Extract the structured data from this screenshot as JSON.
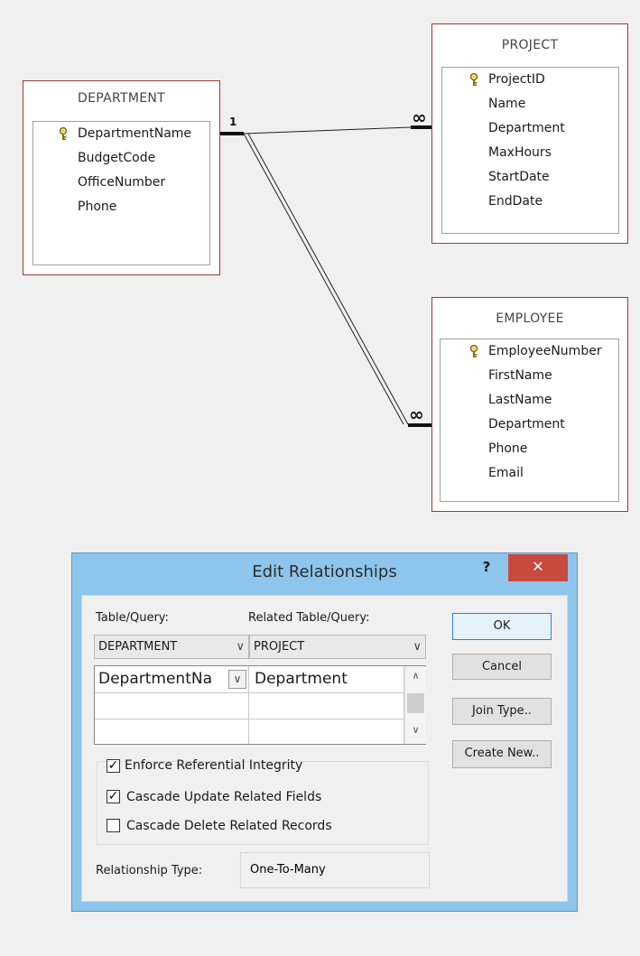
{
  "tables": {
    "department": {
      "title": "DEPARTMENT",
      "fields": [
        "DepartmentName",
        "BudgetCode",
        "OfficeNumber",
        "Phone"
      ]
    },
    "project": {
      "title": "PROJECT",
      "fields": [
        "ProjectID",
        "Name",
        "Department",
        "MaxHours",
        "StartDate",
        "EndDate"
      ]
    },
    "employee": {
      "title": "EMPLOYEE",
      "fields": [
        "EmployeeNumber",
        "FirstName",
        "LastName",
        "Department",
        "Phone",
        "Email"
      ]
    }
  },
  "relationships": {
    "one_label": "1",
    "many_label": "∞"
  },
  "dialog": {
    "title": "Edit Relationships",
    "help": "?",
    "close": "✕",
    "table_query_label": "Table/Query:",
    "related_table_query_label": "Related Table/Query:",
    "table_query_value": "DEPARTMENT",
    "related_table_query_value": "PROJECT",
    "grid": {
      "rows": [
        {
          "left": "DepartmentNa",
          "right": "Department"
        },
        {
          "left": "",
          "right": ""
        },
        {
          "left": "",
          "right": ""
        }
      ]
    },
    "buttons": {
      "ok": "OK",
      "cancel": "Cancel",
      "join_type": "Join Type..",
      "create_new": "Create New.."
    },
    "enforce_label": "Enforce Referential Integrity",
    "enforce_checked": true,
    "cascade_update_label": "Cascade Update Related Fields",
    "cascade_update_checked": true,
    "cascade_delete_label": "Cascade Delete Related Records",
    "cascade_delete_checked": false,
    "relationship_type_label": "Relationship Type:",
    "relationship_type_value": "One-To-Many"
  },
  "colors": {
    "table_border": "#9a3b3b",
    "dialog_frame": "#8ec5ec",
    "close_button": "#c74a3e"
  }
}
